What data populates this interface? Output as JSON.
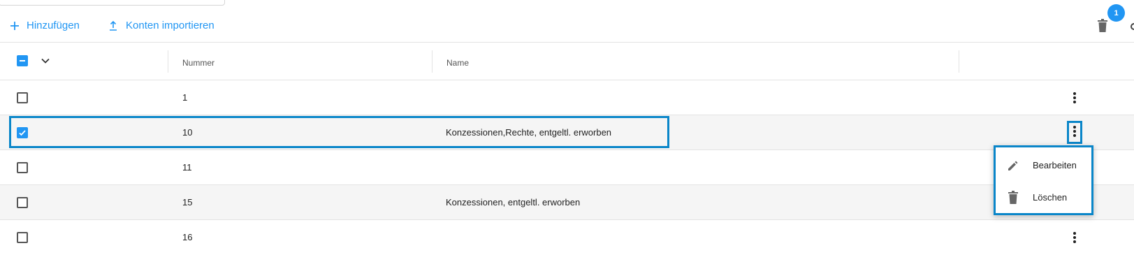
{
  "toolbar": {
    "add_label": "Hinzufügen",
    "import_label": "Konten importieren",
    "badge_count": "1"
  },
  "table": {
    "columns": [
      "Nummer",
      "Name"
    ],
    "rows": [
      {
        "nummer": "1",
        "name": "",
        "checked": false
      },
      {
        "nummer": "10",
        "name": "Konzessionen,Rechte, entgeltl. erworben",
        "checked": true
      },
      {
        "nummer": "11",
        "name": "",
        "checked": false
      },
      {
        "nummer": "15",
        "name": "Konzessionen, entgeltl. erworben",
        "checked": false
      },
      {
        "nummer": "16",
        "name": "",
        "checked": false
      }
    ]
  },
  "context_menu": {
    "edit_label": "Bearbeiten",
    "delete_label": "Löschen"
  },
  "colors": {
    "accent": "#2196f3",
    "highlight": "#0a86c9",
    "row_alt": "#f5f5f5"
  },
  "icons": [
    "plus-icon",
    "upload-icon",
    "trash-icon",
    "chevron-down-icon",
    "kebab-icon",
    "pencil-icon"
  ]
}
